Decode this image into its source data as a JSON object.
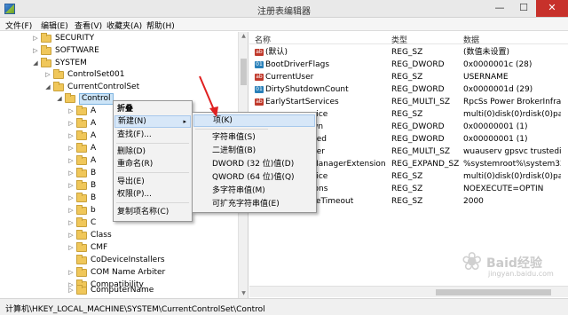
{
  "window": {
    "title": "注册表编辑器",
    "min": "—",
    "max": "☐",
    "close": "✕"
  },
  "menu": [
    "文件(F)",
    "编辑(E)",
    "查看(V)",
    "收藏夹(A)",
    "帮助(H)"
  ],
  "tree": [
    {
      "label": "SECURITY",
      "exp": "▷"
    },
    {
      "label": "SOFTWARE",
      "exp": "▷"
    },
    {
      "label": "SYSTEM",
      "exp": "◢"
    },
    {
      "label": "ControlSet001",
      "exp": "▷"
    },
    {
      "label": "CurrentControlSet",
      "exp": "◢"
    },
    {
      "label": "Control",
      "exp": "◢"
    },
    {
      "label": "A",
      "exp": "▷"
    },
    {
      "label": "A",
      "exp": "▷"
    },
    {
      "label": "A",
      "exp": "▷"
    },
    {
      "label": "A",
      "exp": "▷"
    },
    {
      "label": "A",
      "exp": "▷"
    },
    {
      "label": "B",
      "exp": "▷"
    },
    {
      "label": "B",
      "exp": "▷"
    },
    {
      "label": "B",
      "exp": "▷"
    },
    {
      "label": "b",
      "exp": "▷"
    },
    {
      "label": "C",
      "exp": "▷"
    },
    {
      "label": "Class",
      "exp": "▷"
    },
    {
      "label": "CMF",
      "exp": "▷"
    },
    {
      "label": "CoDeviceInstallers",
      "exp": ""
    },
    {
      "label": "COM Name Arbiter",
      "exp": "▷"
    },
    {
      "label": "Compatibility",
      "exp": "▷"
    },
    {
      "label": "ComputerName",
      "exp": "▷"
    }
  ],
  "list": {
    "headers": {
      "name": "名称",
      "type": "类型",
      "data": "数据"
    },
    "rows": [
      {
        "icon": "ab",
        "name": "(默认)",
        "type": "REG_SZ",
        "data": "(数值未设置)"
      },
      {
        "icon": "01",
        "name": "BootDriverFlags",
        "type": "REG_DWORD",
        "data": "0x0000001c (28)"
      },
      {
        "icon": "ab",
        "name": "CurrentUser",
        "type": "REG_SZ",
        "data": "USERNAME"
      },
      {
        "icon": "01",
        "name": "DirtyShutdownCount",
        "type": "REG_DWORD",
        "data": "0x0000001d (29)"
      },
      {
        "icon": "ab",
        "name": "EarlyStartServices",
        "type": "REG_MULTI_SZ",
        "data": "RpcSs Power BrokerInfrastru"
      },
      {
        "icon": "ab",
        "name": "vice",
        "type": "REG_SZ",
        "data": "multi(0)disk(0)rdisk(0)partitio"
      },
      {
        "icon": "01",
        "name": "wn",
        "type": "REG_DWORD",
        "data": "0x00000001 (1)"
      },
      {
        "icon": "01",
        "name": "ded",
        "type": "REG_DWORD",
        "data": "0x00000001 (1)"
      },
      {
        "icon": "ab",
        "name": "der",
        "type": "REG_MULTI_SZ",
        "data": "wuauserv gpsvc trustedinsta"
      },
      {
        "icon": "ab",
        "name": "ManagerExtension",
        "type": "REG_EXPAND_SZ",
        "data": "%systemroot%\\system32\\sc"
      },
      {
        "icon": "ab",
        "name": "vice",
        "type": "REG_SZ",
        "data": "multi(0)disk(0)rdisk(0)partitio"
      },
      {
        "icon": "ab",
        "name": "ions",
        "type": "REG_SZ",
        "data": " NOEXECUTE=OPTIN"
      },
      {
        "icon": "ab",
        "name": "ceTimeout",
        "type": "REG_SZ",
        "data": "2000"
      }
    ]
  },
  "context_menu": {
    "items": [
      "折叠",
      "新建(N)",
      "查找(F)...",
      "删除(D)",
      "重命名(R)",
      "导出(E)",
      "权限(P)...",
      "复制项名称(C)"
    ],
    "submenu_arrow": "▸"
  },
  "submenu": {
    "items": [
      "项(K)",
      "字符串值(S)",
      "二进制值(B)",
      "DWORD (32 位)值(D)",
      "QWORD (64 位)值(Q)",
      "多字符串值(M)",
      "可扩充字符串值(E)"
    ]
  },
  "status": "计算机\\HKEY_LOCAL_MACHINE\\SYSTEM\\CurrentControlSet\\Control",
  "watermark": {
    "brand": "Baid经验",
    "sub": "jingyan.baidu.com",
    "paw": "❀"
  }
}
